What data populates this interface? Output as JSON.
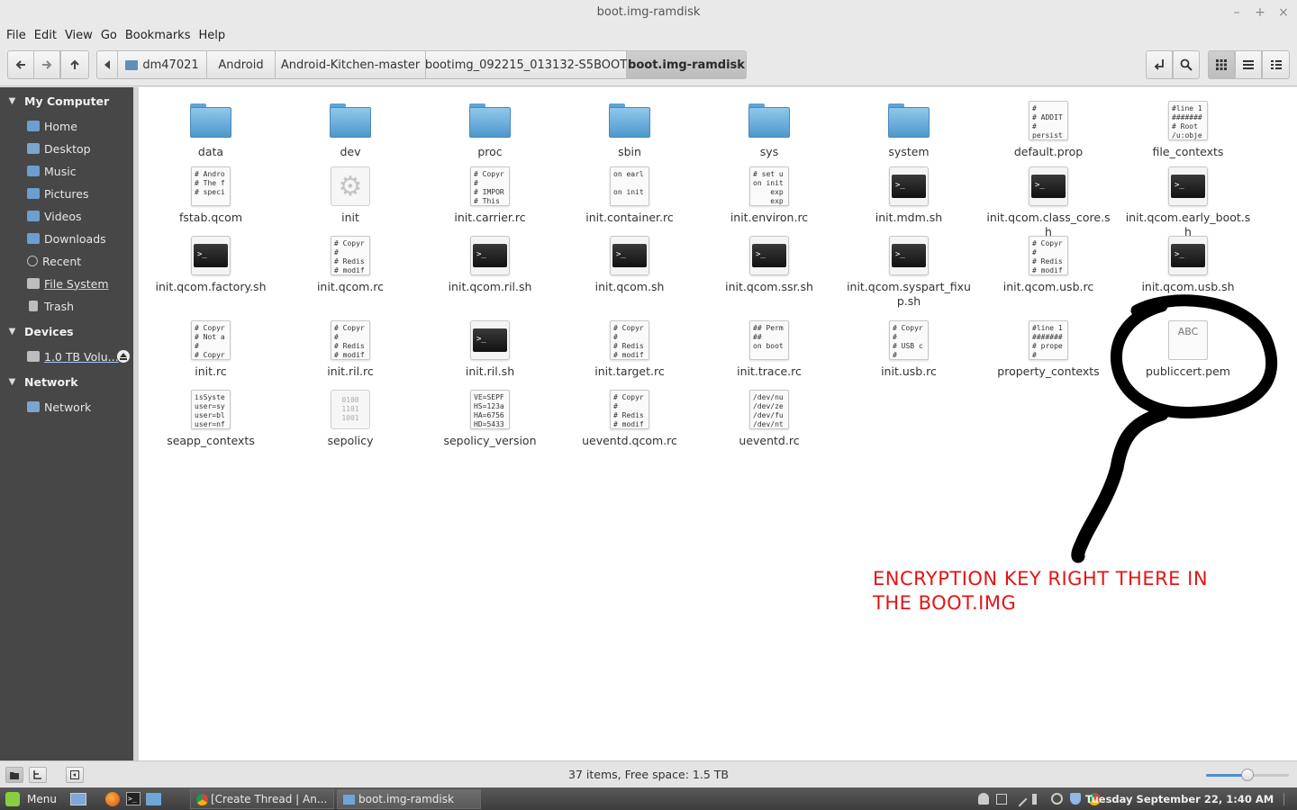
{
  "window": {
    "title": "boot.img-ramdisk",
    "controls": [
      "–",
      "+",
      "×"
    ]
  },
  "menubar": [
    "File",
    "Edit",
    "View",
    "Go",
    "Bookmarks",
    "Help"
  ],
  "toolbar": {
    "breadcrumbs": [
      "dm47021",
      "Android",
      "Android-Kitchen-master",
      "bootimg_092215_013132-S5BOOT",
      "boot.img-ramdisk"
    ],
    "active_crumb": "boot.img-ramdisk"
  },
  "sidebar": {
    "sections": [
      {
        "title": "My Computer",
        "items": [
          {
            "label": "Home",
            "icon": "home-folder-icon"
          },
          {
            "label": "Desktop",
            "icon": "desktop-icon"
          },
          {
            "label": "Music",
            "icon": "music-folder-icon"
          },
          {
            "label": "Pictures",
            "icon": "pictures-folder-icon"
          },
          {
            "label": "Videos",
            "icon": "videos-folder-icon"
          },
          {
            "label": "Downloads",
            "icon": "downloads-folder-icon"
          },
          {
            "label": "Recent",
            "icon": "recent-icon"
          },
          {
            "label": "File System",
            "icon": "drive-icon"
          },
          {
            "label": "Trash",
            "icon": "trash-icon"
          }
        ]
      },
      {
        "title": "Devices",
        "items": [
          {
            "label": "1.0 TB Volu...",
            "icon": "drive-icon"
          }
        ]
      },
      {
        "title": "Network",
        "items": [
          {
            "label": "Network",
            "icon": "network-icon"
          }
        ]
      }
    ]
  },
  "files": [
    {
      "name": "data",
      "type": "folder"
    },
    {
      "name": "dev",
      "type": "folder"
    },
    {
      "name": "proc",
      "type": "folder"
    },
    {
      "name": "sbin",
      "type": "folder"
    },
    {
      "name": "sys",
      "type": "folder"
    },
    {
      "name": "system",
      "type": "folder"
    },
    {
      "name": "default.prop",
      "type": "text",
      "preview": "#\n# ADDIT\n#\npersist"
    },
    {
      "name": "file_contexts",
      "type": "text",
      "preview": "#line 1\n#######\n# Root\n/u:obje"
    },
    {
      "name": "fstab.qcom",
      "type": "text",
      "preview": "# Andro\n# The f\n# speci"
    },
    {
      "name": "init",
      "type": "gear"
    },
    {
      "name": "init.carrier.rc",
      "type": "text",
      "preview": "# Copyr\n#\n# IMPOR\n# This"
    },
    {
      "name": "init.container.rc",
      "type": "text",
      "preview": "on earl\n\non init"
    },
    {
      "name": "init.environ.rc",
      "type": "text",
      "preview": "# set u\non init\n    exp\n    exp"
    },
    {
      "name": "init.mdm.sh",
      "type": "script"
    },
    {
      "name": "init.qcom.class_core.sh",
      "type": "script"
    },
    {
      "name": "init.qcom.early_boot.sh",
      "type": "script"
    },
    {
      "name": "init.qcom.factory.sh",
      "type": "script"
    },
    {
      "name": "init.qcom.rc",
      "type": "text",
      "preview": "# Copyr\n#\n# Redis\n# modif"
    },
    {
      "name": "init.qcom.ril.sh",
      "type": "script"
    },
    {
      "name": "init.qcom.sh",
      "type": "script"
    },
    {
      "name": "init.qcom.ssr.sh",
      "type": "script"
    },
    {
      "name": "init.qcom.syspart_fixup.sh",
      "type": "script"
    },
    {
      "name": "init.qcom.usb.rc",
      "type": "text",
      "preview": "# Copyr\n#\n# Redis\n# modif"
    },
    {
      "name": "init.qcom.usb.sh",
      "type": "script"
    },
    {
      "name": "init.rc",
      "type": "text",
      "preview": "# Copyr\n# Not a\n#\n# Copyr"
    },
    {
      "name": "init.ril.rc",
      "type": "text",
      "preview": "# Copyr\n#\n# Redis\n# modif"
    },
    {
      "name": "init.ril.sh",
      "type": "script"
    },
    {
      "name": "init.target.rc",
      "type": "text",
      "preview": "# Copyr\n#\n# Redis\n# modif"
    },
    {
      "name": "init.trace.rc",
      "type": "text",
      "preview": "## Perm\n##\non boot"
    },
    {
      "name": "init.usb.rc",
      "type": "text",
      "preview": "# Copyr\n#\n# USB c\n#"
    },
    {
      "name": "property_contexts",
      "type": "text",
      "preview": "#line 1\n#######\n# prope\n#"
    },
    {
      "name": "publiccert.pem",
      "type": "abc",
      "preview": "ABC"
    },
    {
      "name": "seapp_contexts",
      "type": "text",
      "preview": "isSyste\nuser=sy\nuser=bl\nuser=nf"
    },
    {
      "name": "sepolicy",
      "type": "binary",
      "preview": "0100\n1101\n1001"
    },
    {
      "name": "sepolicy_version",
      "type": "text",
      "preview": "VE=SEPF\nHS=123a\nHA=6756\nHD=5433"
    },
    {
      "name": "ueventd.qcom.rc",
      "type": "text",
      "preview": "# Copyr\n#\n# Redis\n# modif"
    },
    {
      "name": "ueventd.rc",
      "type": "text",
      "preview": "/dev/nu\n/dev/ze\n/dev/fu\n/dev/nt"
    }
  ],
  "annotation": {
    "text_line1": "ENCRYPTION KEY RIGHT THERE IN",
    "text_line2": "THE BOOT.IMG",
    "color": "#e31414"
  },
  "statusbar": {
    "text": "37 items, Free space: 1.5 TB",
    "zoom_level": 0.5
  },
  "taskbar": {
    "menu_label": "Menu",
    "tasks": [
      "[Create Thread | An...",
      "boot.img-ramdisk"
    ],
    "clock": "Tuesday September 22,  1:40 AM"
  },
  "colors": {
    "sidebar_bg": "#474747",
    "folder_blue": "#4f97cc",
    "selection_accent": "#4c8ed9"
  }
}
